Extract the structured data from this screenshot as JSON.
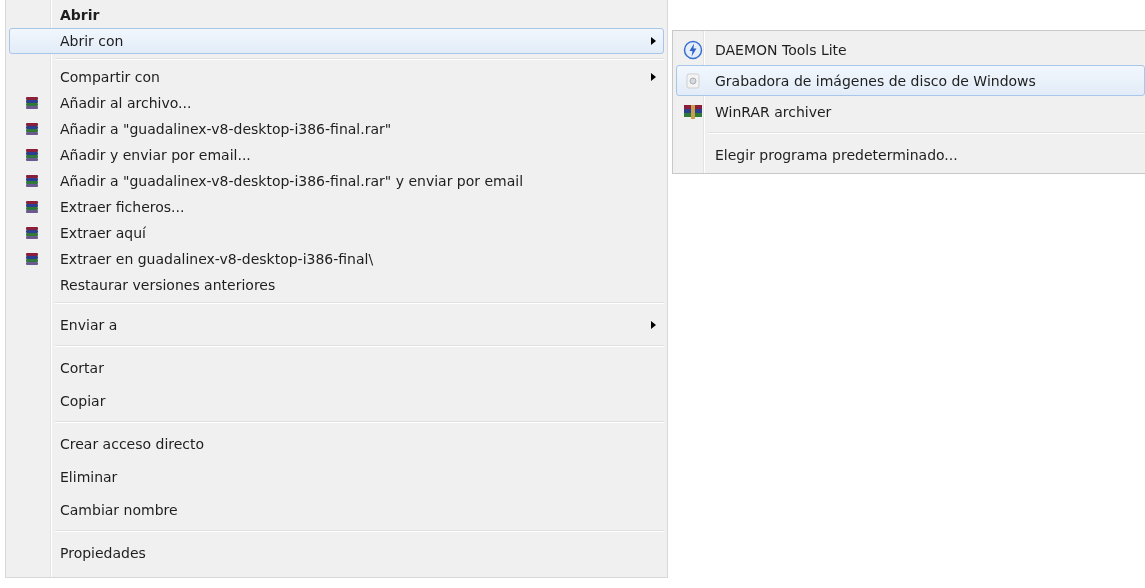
{
  "context_menu": {
    "items": [
      {
        "kind": "item",
        "label": "Abrir",
        "default": true,
        "selected": false,
        "submenu": false
      },
      {
        "kind": "item",
        "label": "Abrir con",
        "default": false,
        "selected": true,
        "submenu": true
      },
      {
        "kind": "separator"
      },
      {
        "kind": "item",
        "label": "Compartir con",
        "default": false,
        "selected": false,
        "submenu": true
      },
      {
        "kind": "rar",
        "label": "Añadir al archivo...",
        "default": false,
        "selected": false,
        "submenu": false
      },
      {
        "kind": "rar",
        "label": "Añadir a \"guadalinex-v8-desktop-i386-final.rar\"",
        "default": false,
        "selected": false,
        "submenu": false
      },
      {
        "kind": "rar",
        "label": "Añadir y enviar por email...",
        "default": false,
        "selected": false,
        "submenu": false
      },
      {
        "kind": "rar",
        "label": "Añadir a \"guadalinex-v8-desktop-i386-final.rar\" y enviar por email",
        "default": false,
        "selected": false,
        "submenu": false
      },
      {
        "kind": "rar",
        "label": "Extraer ficheros...",
        "default": false,
        "selected": false,
        "submenu": false
      },
      {
        "kind": "rar",
        "label": "Extraer aquí",
        "default": false,
        "selected": false,
        "submenu": false
      },
      {
        "kind": "rar",
        "label": "Extraer en guadalinex-v8-desktop-i386-final\\",
        "default": false,
        "selected": false,
        "submenu": false
      },
      {
        "kind": "item",
        "label": "Restaurar versiones anteriores",
        "default": false,
        "selected": false,
        "submenu": false
      },
      {
        "kind": "separator"
      },
      {
        "kind": "item",
        "label": "Enviar a",
        "default": false,
        "selected": false,
        "submenu": true
      },
      {
        "kind": "separator"
      },
      {
        "kind": "item",
        "label": "Cortar",
        "default": false,
        "selected": false,
        "submenu": false
      },
      {
        "kind": "item",
        "label": "Copiar",
        "default": false,
        "selected": false,
        "submenu": false
      },
      {
        "kind": "separator"
      },
      {
        "kind": "item",
        "label": "Crear acceso directo",
        "default": false,
        "selected": false,
        "submenu": false
      },
      {
        "kind": "item",
        "label": "Eliminar",
        "default": false,
        "selected": false,
        "submenu": false
      },
      {
        "kind": "item",
        "label": "Cambiar nombre",
        "default": false,
        "selected": false,
        "submenu": false
      },
      {
        "kind": "separator"
      },
      {
        "kind": "item",
        "label": "Propiedades",
        "default": false,
        "selected": false,
        "submenu": false
      }
    ]
  },
  "submenu": {
    "items": [
      {
        "kind": "daemon",
        "label": "DAEMON Tools Lite",
        "selected": false
      },
      {
        "kind": "disc",
        "label": "Grabadora de imágenes de disco de Windows",
        "selected": true
      },
      {
        "kind": "rar",
        "label": "WinRAR archiver",
        "selected": false
      },
      {
        "kind": "separator"
      },
      {
        "kind": "item",
        "label": "Elegir programa predeterminado...",
        "selected": false
      }
    ]
  }
}
